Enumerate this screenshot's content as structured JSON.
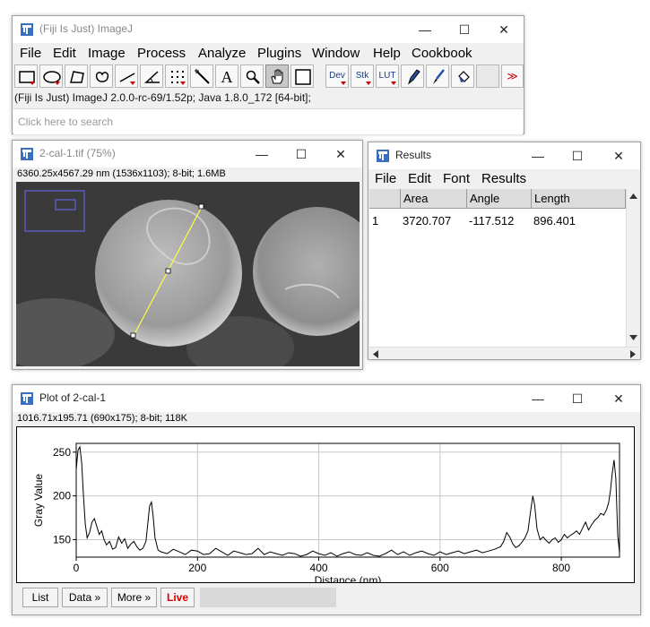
{
  "imagej": {
    "title": "(Fiji Is Just) ImageJ",
    "menus": [
      "File",
      "Edit",
      "Image",
      "Process",
      "Analyze",
      "Plugins",
      "Window",
      "Help",
      "Cookbook"
    ],
    "tools": {
      "text_tool": "A",
      "dev_label": "Dev",
      "stk_label": "Stk",
      "lut_label": "LUT",
      "more_label": "≫"
    },
    "status": "(Fiji Is Just) ImageJ 2.0.0-rc-69/1.52p; Java 1.8.0_172 [64-bit];",
    "search_placeholder": "Click here to search"
  },
  "image_window": {
    "title": "2-cal-1.tif (75%)",
    "info": "6360.25x4567.29 nm (1536x1103); 8-bit; 1.6MB"
  },
  "results": {
    "title": "Results",
    "menus": [
      "File",
      "Edit",
      "Font",
      "Results"
    ],
    "columns": [
      "",
      "Area",
      "Angle",
      "Length"
    ],
    "rows": [
      {
        "index": "1",
        "area": "3720.707",
        "angle": "-117.512",
        "length": "896.401"
      }
    ]
  },
  "plot_window": {
    "title": "Plot of 2-cal-1",
    "info": "1016.71x195.71  (690x175); 8-bit; 118K",
    "buttons": {
      "list": "List",
      "data": "Data »",
      "more": "More »",
      "live": "Live"
    },
    "live_color": "#e00000"
  },
  "chart_data": {
    "type": "line",
    "title": "",
    "xlabel": "Distance (nm)",
    "ylabel": "Gray Value",
    "xlim": [
      0,
      896
    ],
    "ylim": [
      130,
      260
    ],
    "xticks": [
      "0",
      "200",
      "400",
      "600",
      "800"
    ],
    "yticks": [
      "150",
      "200",
      "250"
    ],
    "grid": true,
    "series": [
      {
        "name": "",
        "color": "#000000",
        "x": [
          0,
          3,
          6,
          9,
          12,
          15,
          18,
          22,
          26,
          30,
          34,
          38,
          42,
          46,
          50,
          55,
          60,
          65,
          70,
          75,
          80,
          85,
          90,
          95,
          100,
          105,
          110,
          115,
          118,
          121,
          124,
          127,
          130,
          135,
          140,
          150,
          160,
          170,
          180,
          190,
          200,
          210,
          220,
          230,
          240,
          250,
          260,
          270,
          280,
          290,
          300,
          310,
          320,
          330,
          340,
          350,
          360,
          370,
          380,
          390,
          400,
          410,
          420,
          430,
          440,
          450,
          460,
          470,
          480,
          490,
          500,
          510,
          520,
          530,
          540,
          550,
          560,
          570,
          580,
          590,
          600,
          610,
          620,
          630,
          640,
          650,
          660,
          670,
          680,
          690,
          700,
          705,
          710,
          715,
          720,
          725,
          730,
          735,
          740,
          745,
          750,
          753,
          756,
          760,
          765,
          770,
          775,
          780,
          785,
          790,
          795,
          800,
          805,
          810,
          815,
          820,
          825,
          830,
          835,
          840,
          845,
          850,
          855,
          860,
          865,
          870,
          875,
          878,
          881,
          884,
          887,
          890,
          893,
          896
        ],
        "y": [
          230,
          252,
          256,
          238,
          200,
          168,
          152,
          158,
          170,
          174,
          165,
          156,
          160,
          150,
          144,
          148,
          139,
          141,
          153,
          146,
          151,
          140,
          145,
          148,
          142,
          138,
          140,
          148,
          168,
          188,
          193,
          176,
          152,
          138,
          136,
          134,
          139,
          136,
          133,
          138,
          137,
          133,
          134,
          140,
          136,
          132,
          137,
          135,
          133,
          134,
          140,
          133,
          136,
          134,
          132,
          135,
          134,
          131,
          133,
          137,
          134,
          132,
          135,
          131,
          134,
          136,
          133,
          132,
          135,
          132,
          131,
          134,
          138,
          133,
          136,
          132,
          135,
          137,
          134,
          132,
          136,
          133,
          135,
          137,
          134,
          136,
          138,
          135,
          137,
          139,
          142,
          148,
          158,
          153,
          145,
          141,
          143,
          147,
          152,
          160,
          186,
          200,
          190,
          162,
          150,
          153,
          149,
          146,
          150,
          152,
          147,
          150,
          156,
          152,
          155,
          157,
          160,
          156,
          163,
          170,
          161,
          167,
          172,
          175,
          180,
          178,
          185,
          192,
          206,
          226,
          241,
          220,
          155,
          135
        ]
      }
    ]
  }
}
